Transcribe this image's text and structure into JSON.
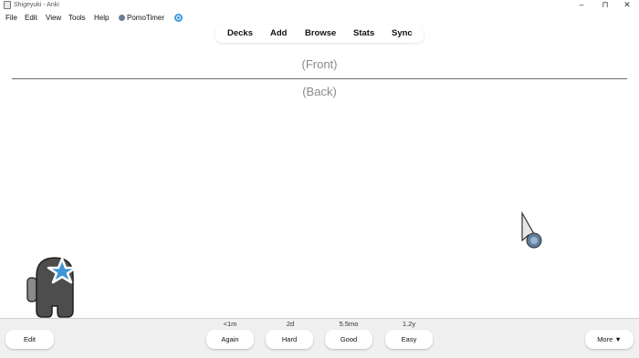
{
  "window": {
    "title": "Shigeyuki - Anki",
    "minimize": "–",
    "maximize": "⊓",
    "close": ""
  },
  "menu": {
    "file": "File",
    "edit": "Edit",
    "view": "View",
    "tools": "Tools",
    "help": "Help",
    "pomotimer": "PomoTimer"
  },
  "toolbar": {
    "decks": "Decks",
    "add": "Add",
    "browse": "Browse",
    "stats": "Stats",
    "sync": "Sync"
  },
  "card": {
    "front": "(Front)",
    "back": "(Back)"
  },
  "bottom": {
    "edit": "Edit",
    "more": "More ▼",
    "answers": [
      {
        "label": "Again",
        "interval": "<1m"
      },
      {
        "label": "Hard",
        "interval": "2d"
      },
      {
        "label": "Good",
        "interval": "5.5mo"
      },
      {
        "label": "Easy",
        "interval": "1.2y"
      }
    ]
  },
  "colors": {
    "sync_indicator": "#3d9be0",
    "card_text": "#8a8a8a",
    "bottom_bar": "#f0f0f0",
    "mascot_body": "#4d4d4d",
    "mascot_star": "#3f95d6"
  },
  "icons": [
    "app-icon",
    "pomotimer-icon",
    "sync-status-icon",
    "among-us-mascot-icon",
    "cursor-icon"
  ]
}
